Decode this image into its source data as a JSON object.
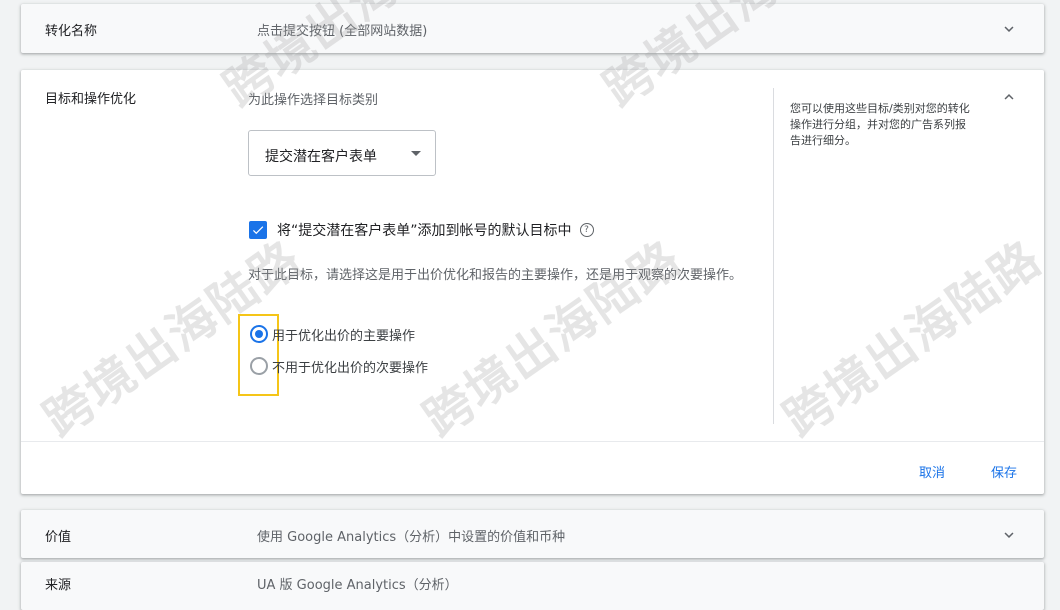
{
  "rows": {
    "conversion_name": {
      "label": "转化名称",
      "value": "点击提交按钮 (全部网站数据)"
    },
    "goal": {
      "label": "目标和操作优化",
      "subtitle": "为此操作选择目标类别",
      "dropdown_value": "提交潜在客户表单",
      "checkbox_label": "将“提交潜在客户表单”添加到帐号的默认目标中",
      "checkbox_checked": true,
      "help_icon_glyph": "?",
      "description": "对于此目标，请选择这是用于出价优化和报告的主要操作，还是用于观察的次要操作。",
      "options": [
        {
          "label": "用于优化出价的主要操作",
          "checked": true
        },
        {
          "label": "不用于优化出价的次要操作",
          "checked": false
        }
      ],
      "side_note": "您可以使用这些目标/类别对您的转化操作进行分组，并对您的广告系列报告进行细分。",
      "cancel_label": "取消",
      "save_label": "保存"
    },
    "value": {
      "label": "价值",
      "value": "使用 Google Analytics（分析）中设置的价值和币种"
    },
    "source": {
      "label": "来源",
      "value": "UA 版 Google Analytics（分析）"
    }
  },
  "watermark_text": "跨境出海陆路",
  "colors": {
    "accent": "#1a73e8",
    "highlight": "#f5c518"
  }
}
